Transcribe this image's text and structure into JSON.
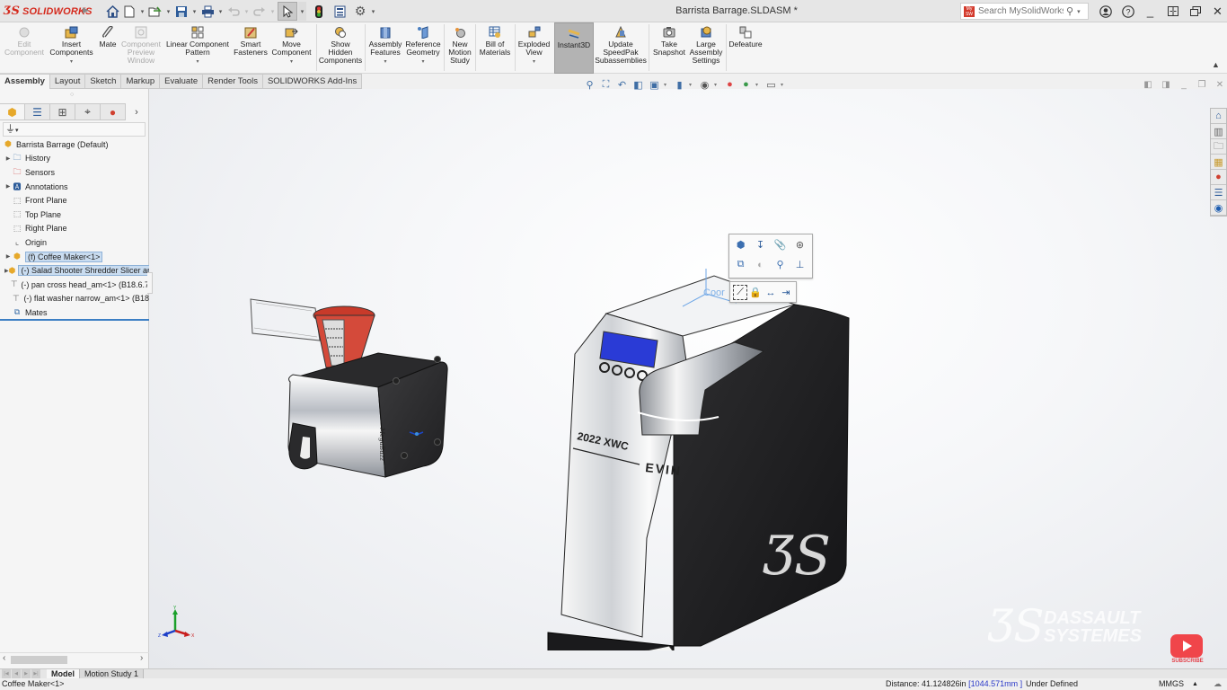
{
  "app": {
    "brand": "SOLIDWORKS",
    "brand_prefix": "3DS",
    "document_title": "Barrista Barrage.SLDASM *"
  },
  "quick_access": [
    {
      "name": "home",
      "icon": "home-icon"
    },
    {
      "name": "new",
      "icon": "new-document-icon",
      "dropdown": true
    },
    {
      "name": "open",
      "icon": "open-folder-icon",
      "dropdown": true
    },
    {
      "name": "save",
      "icon": "save-icon",
      "dropdown": true
    },
    {
      "name": "print",
      "icon": "print-icon",
      "dropdown": true
    },
    {
      "name": "undo",
      "icon": "undo-icon",
      "dropdown": true,
      "disabled": true
    },
    {
      "name": "redo",
      "icon": "redo-icon",
      "dropdown": true,
      "disabled": true
    },
    {
      "name": "select",
      "icon": "select-arrow-icon",
      "dropdown": true,
      "selected": true
    },
    {
      "name": "rebuild",
      "icon": "traffic-light-icon"
    },
    {
      "name": "file-properties",
      "icon": "file-properties-icon"
    },
    {
      "name": "options",
      "icon": "gear-icon",
      "dropdown": true
    }
  ],
  "search": {
    "placeholder": "Search MySolidWorks",
    "badge": "My SW"
  },
  "window_controls": [
    "account",
    "help",
    "minimize",
    "tile",
    "restore",
    "close"
  ],
  "command_manager": [
    {
      "label": "Edit Component",
      "icon": "edit-component-icon",
      "disabled": true
    },
    {
      "label": "Insert Components",
      "icon": "insert-components-icon",
      "dropdown": true
    },
    {
      "label": "Mate",
      "icon": "mate-paperclip-icon"
    },
    {
      "label": "Component Preview Window",
      "icon": "component-preview-icon",
      "disabled": true
    },
    {
      "label": "Linear Component Pattern",
      "icon": "linear-pattern-icon",
      "dropdown": true
    },
    {
      "label": "Smart Fasteners",
      "icon": "smart-fasteners-icon"
    },
    {
      "label": "Move Component",
      "icon": "move-component-icon",
      "dropdown": true
    },
    {
      "label": "Show Hidden Components",
      "icon": "show-hidden-icon"
    },
    {
      "label": "Assembly Features",
      "icon": "assembly-features-icon",
      "dropdown": true
    },
    {
      "label": "Reference Geometry",
      "icon": "reference-geometry-icon",
      "dropdown": true
    },
    {
      "label": "New Motion Study",
      "icon": "motion-study-icon"
    },
    {
      "label": "Bill of Materials",
      "icon": "bill-of-materials-icon"
    },
    {
      "label": "Exploded View",
      "icon": "exploded-view-icon",
      "dropdown": true
    },
    {
      "label": "Instant3D",
      "icon": "instant3d-icon",
      "active": true
    },
    {
      "label": "Update SpeedPak Subassemblies",
      "icon": "speedpak-icon"
    },
    {
      "label": "Take Snapshot",
      "icon": "camera-icon"
    },
    {
      "label": "Large Assembly Settings",
      "icon": "large-assembly-icon"
    },
    {
      "label": "Defeature",
      "icon": "defeature-icon"
    }
  ],
  "tabs": [
    {
      "label": "Assembly",
      "active": true
    },
    {
      "label": "Layout"
    },
    {
      "label": "Sketch"
    },
    {
      "label": "Markup"
    },
    {
      "label": "Evaluate"
    },
    {
      "label": "Render Tools"
    },
    {
      "label": "SOLIDWORKS Add-Ins"
    }
  ],
  "feature_manager": {
    "panel_tabs": [
      "featuremanager-icon",
      "propertymanager-icon",
      "configurationmanager-icon",
      "dimxpertmanager-icon",
      "displaymanager-icon"
    ],
    "tree": [
      {
        "label": "Barrista Barrage  (Default)",
        "icon": "assembly-icon",
        "level": 0
      },
      {
        "label": "History",
        "icon": "history-folder-icon",
        "level": 1,
        "expandable": true
      },
      {
        "label": "Sensors",
        "icon": "sensors-folder-icon",
        "level": 1
      },
      {
        "label": "Annotations",
        "icon": "annotations-folder-icon",
        "level": 1,
        "expandable": true
      },
      {
        "label": "Front Plane",
        "icon": "plane-icon",
        "level": 1
      },
      {
        "label": "Top Plane",
        "icon": "plane-icon",
        "level": 1
      },
      {
        "label": "Right Plane",
        "icon": "plane-icon",
        "level": 1
      },
      {
        "label": "Origin",
        "icon": "origin-icon",
        "level": 1
      },
      {
        "label": "(f) Coffee Maker<1>",
        "icon": "subassembly-icon",
        "level": 1,
        "expandable": true,
        "selected": true
      },
      {
        "label": "(-) Salad Shooter Shredder Slicer ar",
        "icon": "subassembly-icon",
        "level": 1,
        "expandable": true,
        "selected": true
      },
      {
        "label": "(-) pan cross head_am<1> (B18.6.7",
        "icon": "screw-part-icon",
        "level": 1
      },
      {
        "label": "(-) flat washer narrow_am<1> (B18",
        "icon": "screw-part-icon",
        "level": 1
      },
      {
        "label": "Mates",
        "icon": "mates-icon",
        "level": 1
      }
    ]
  },
  "bottom_tabs": [
    {
      "label": "Model",
      "active": true
    },
    {
      "label": "Motion Study 1"
    }
  ],
  "status_bar": {
    "selection": "Coffee Maker<1>",
    "distance_label": "Distance: 41.124826in",
    "distance_mm": "[1044.571mm ]",
    "definition": "Under Defined",
    "units": "MMGS"
  },
  "viewport": {
    "heads_up_toolbar": [
      "zoom-to-fit-icon",
      "zoom-to-area-icon",
      "previous-view-icon",
      "section-view-icon",
      "view-orientation-icon",
      "display-style-icon",
      "hide-show-items-icon",
      "edit-appearance-icon",
      "apply-scene-icon",
      "view-settings-icon"
    ],
    "task_pane": [
      "solidworks-resources-icon",
      "design-library-icon",
      "file-explorer-icon",
      "view-palette-icon",
      "appearances-icon",
      "custom-properties-icon",
      "3dexperience-icon"
    ],
    "context_toolbar_row1": [
      "make-virtual-icon",
      "insert-mate-icon",
      "mate-icon",
      "hide-show-icon",
      "open-part-icon",
      "hide-icon",
      "zoom-to-selection-icon",
      "normal-to-icon"
    ],
    "context_toolbar_row2": [
      "smart-dimension-icon",
      "fix-lock-icon",
      "horizontal-dimension-icon",
      "vertical-dimension-icon"
    ],
    "coordinate_label": "Coor",
    "triad_axes": [
      "X",
      "Y",
      "Z"
    ],
    "model_texts": {
      "coffee_maker_model": "2022 XWC",
      "coffee_maker_brand": "EVIN",
      "shredder_brand": "MegaBuzz"
    },
    "watermark": [
      "DASSAULT",
      "SYSTEMES"
    ],
    "subscribe_label": "SUBSCRIBE"
  }
}
